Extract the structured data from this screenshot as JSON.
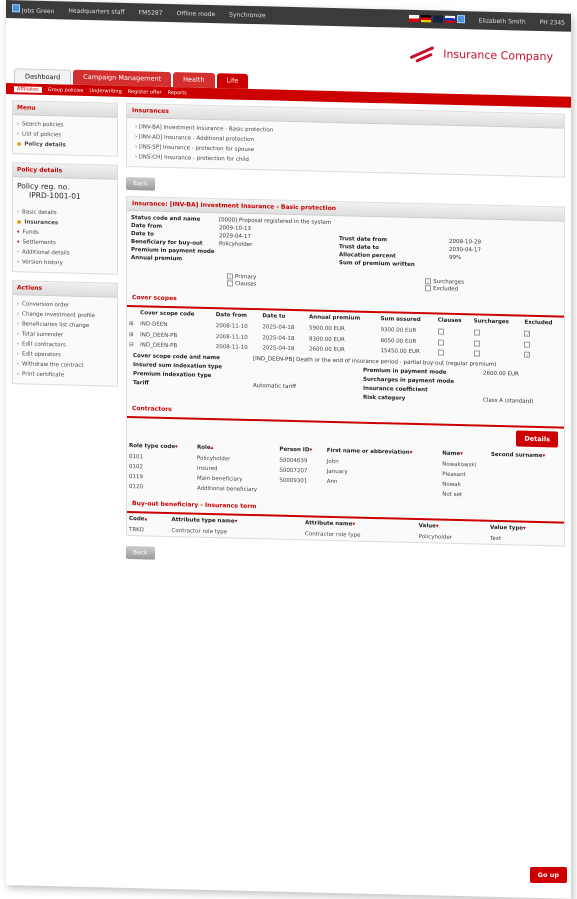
{
  "topbar": {
    "user": "Jobs Green",
    "role": "Headquarters staff",
    "code": "FM5287",
    "offline": "Offline mode",
    "sync": "Synchronize",
    "person": "Elizabeth Smith",
    "id": "PH 2345"
  },
  "header": {
    "logo": "Insurance Company"
  },
  "tabs": [
    "Dashboard",
    "Campaign Management",
    "Health",
    "Life"
  ],
  "subnav": [
    "Affiliates",
    "Group policies",
    "Underwriting",
    "Register offer",
    "Reports"
  ],
  "menu": {
    "title": "Menu",
    "items": [
      "Search policies",
      "List of policies",
      "Policy details"
    ]
  },
  "policy": {
    "title": "Policy details",
    "reg_label": "Policy reg. no.",
    "reg_no": "IPRD-1001-01",
    "items": [
      "Basic details",
      "Insurances",
      "Funds",
      "Settlements",
      "Additional details",
      "Version history"
    ]
  },
  "actions": {
    "title": "Actions",
    "items": [
      "Conversion order",
      "Change investment profile",
      "Beneficiaries list change",
      "Total surrender",
      "Edit contractors",
      "Edit operators",
      "Withdraw the contract",
      "Print certificate"
    ]
  },
  "insurances": {
    "title": "Insurances",
    "items": [
      "[INV-BA] Investment Insurance - Basic protection",
      "[INV-AD] Insurance - Additional protection",
      "[INS-SP] Insurance - protection for spouse",
      "[INS-CH] Insurance - protection for child"
    ]
  },
  "back": "Back",
  "detail": {
    "title": "Insurance: [INV-BA] Investment Insurance - Basic protection",
    "status_label": "Status code and name",
    "status": "[0000] Proposal registered in the system",
    "date_from_label": "Date from",
    "date_from": "2009-10-13",
    "date_to_label": "Date to",
    "date_to": "2029-04-17",
    "benef_label": "Beneficiary for buy-out",
    "benef": "Policyholder",
    "prem_mode_label": "Premium in payment mode",
    "annual_label": "Annual premium",
    "trust_from_label": "Trust date from",
    "trust_from": "2008-10-29",
    "trust_to_label": "Trust date to",
    "trust_to": "2030-04-17",
    "alloc_label": "Allocation percent",
    "alloc": "99%",
    "sum_label": "Sum of premium written",
    "primary": "Primary",
    "clauses": "Clauses",
    "surcharges": "Surcharges",
    "excluded": "Excluded"
  },
  "cover": {
    "title": "Cover scopes",
    "headers": [
      "Cover scope code",
      "Date from",
      "Date to",
      "Annual premium",
      "Sum assured",
      "Clauses",
      "Surcharges",
      "Excluded"
    ],
    "rows": [
      [
        "IND-DEEN",
        "2008-11-10",
        "2025-04-18",
        "5900.00 EUR",
        "9300.00 EUR"
      ],
      [
        "IND_DEEN-PB",
        "2008-11-10",
        "2025-04-18",
        "8300.00 EUR",
        "8050.00 EUR"
      ],
      [
        "IND_DEEN-PB",
        "2008-11-10",
        "2025-04-18",
        "2600.00 EUR",
        "15450.00 EUR"
      ]
    ],
    "code_label": "Cover scope code and name",
    "code_val": "[IND_DEEN-PB] Death or the end of insurance period - partial buy-out (regular premium)",
    "sum_index": "Insured sum indexation type",
    "prem_index": "Premium indexation type",
    "tariff": "Tariff",
    "tariff_val": "Automatic tariff",
    "pm_label": "Premium in payment mode",
    "pm_val": "2600.00 EUR",
    "sc_label": "Surcharges in payment mode",
    "coef": "Insurance coefficient",
    "risk": "Risk category",
    "risk_val": "Class A (standard)"
  },
  "contractors": {
    "title": "Contractors",
    "details": "Details",
    "headers": [
      "Role type code",
      "Role",
      "Person ID",
      "First name or abbreviation",
      "Name",
      "Second surname"
    ],
    "rows": [
      [
        "0101",
        "Policyholder",
        "S0004639",
        "John",
        "Nowakowski"
      ],
      [
        "0102",
        "Insured",
        "S0007207",
        "January",
        "Pleasant"
      ],
      [
        "0119",
        "Main beneficiary",
        "S0009301",
        "Ann",
        "Nowak"
      ],
      [
        "0120",
        "Additional beneficiary",
        "",
        "",
        "Not set"
      ]
    ]
  },
  "buyout": {
    "title": "Buy-out beneficiary - Insurance term",
    "headers": [
      "Code",
      "Attribute type name",
      "Attribute name",
      "Value",
      "Value type"
    ],
    "row": [
      "TRKO",
      "Contractor role type",
      "Contractor role type",
      "Policyholder",
      "Text"
    ]
  },
  "goup": "Go up"
}
